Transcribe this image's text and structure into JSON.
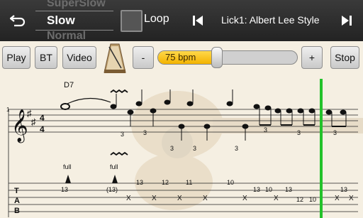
{
  "topbar": {
    "speed_prev": "SuperSlow",
    "speed_selected": "Slow",
    "speed_next": "Normal",
    "loop_label": "Loop",
    "lick_title": "Lick1: Albert Lee Style"
  },
  "controls": {
    "play": "Play",
    "bt": "BT",
    "video": "Video",
    "minus": "-",
    "bpm": "75 bpm",
    "tempo_fraction": 0.42,
    "plus": "+",
    "stop": "Stop"
  },
  "score": {
    "chord": "D7",
    "measure_number": "1",
    "time_signature_top": "4",
    "time_signature_bottom": "4",
    "tuplet": "3",
    "bend_labels": [
      "full",
      "full"
    ],
    "tab_clef": [
      "T",
      "A",
      "B"
    ],
    "tab_numbers": [
      "13",
      "(13)",
      "13",
      "12",
      "11",
      "10",
      "13",
      "10",
      "13",
      "12",
      "10",
      "13"
    ],
    "dead_note": "X"
  },
  "colors": {
    "playhead": "#22c22a",
    "tempo_fill": "#f5b800",
    "topbar": "#2b2b2b"
  }
}
